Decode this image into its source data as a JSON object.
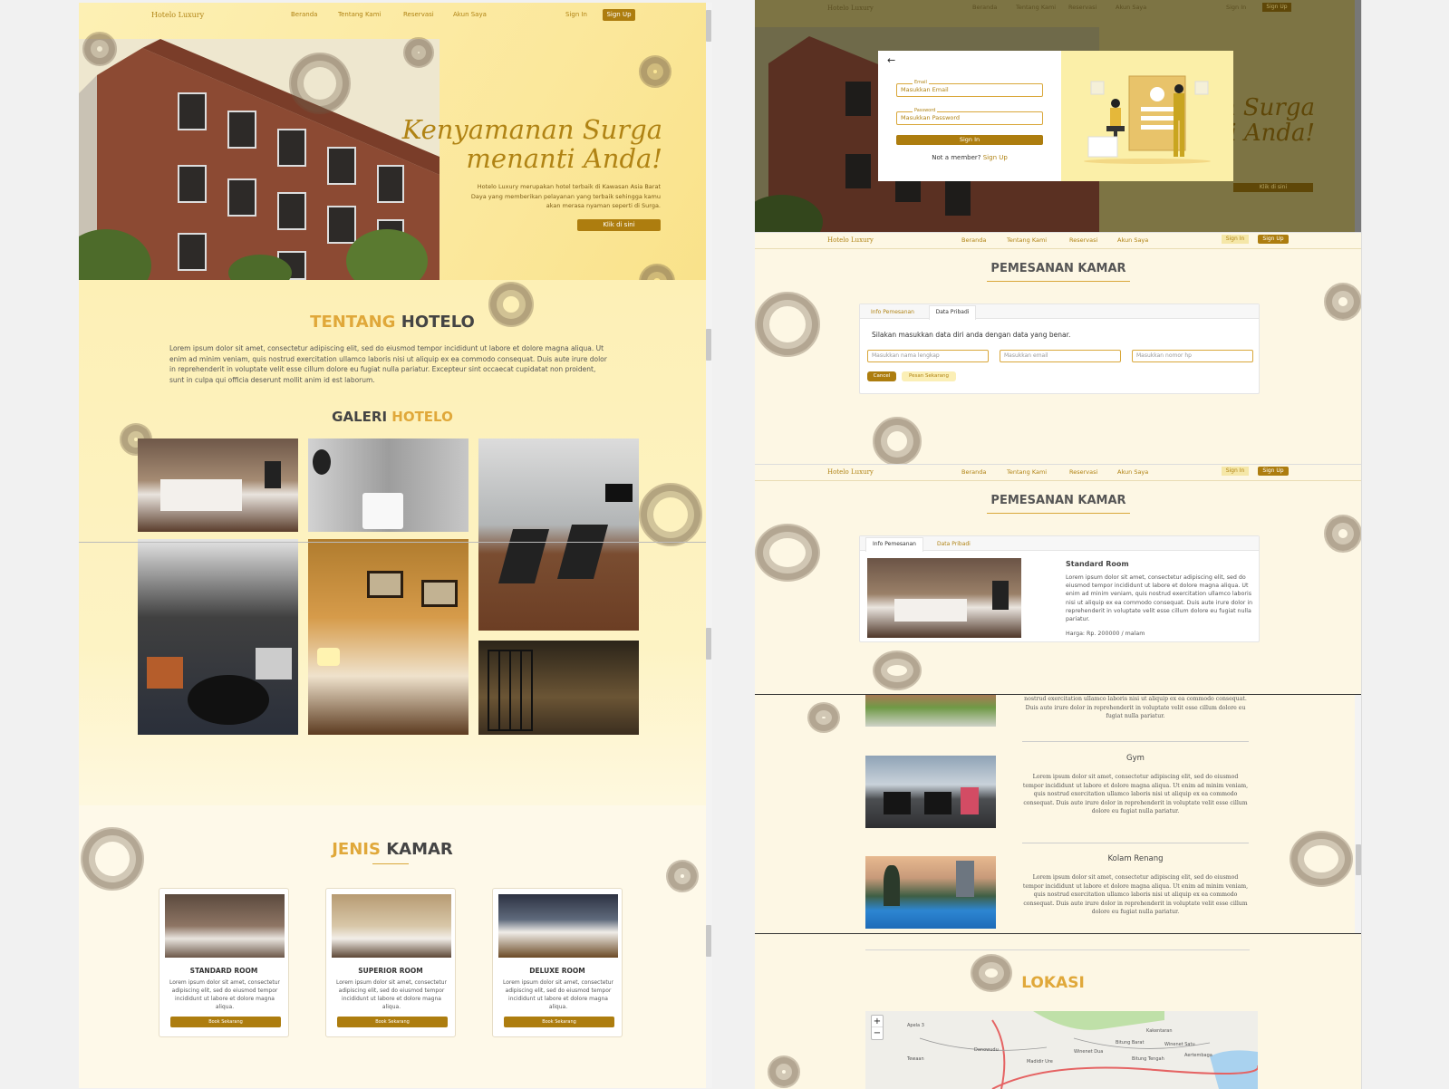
{
  "brand": "Hotelo Luxury",
  "nav": [
    "Beranda",
    "Tentang Kami",
    "Reservasi",
    "Akun Saya"
  ],
  "auth": {
    "signin": "Sign In",
    "signup": "Sign Up"
  },
  "hero": {
    "title_line1": "Kenyamanan Surga",
    "title_line2": "menanti Anda!",
    "text": "Hotelo Luxury merupakan hotel terbaik di Kawasan Asia Barat Daya yang memberikan pelayanan yang terbaik sehingga kamu akan merasa nyaman seperti di Surga.",
    "cta": "Klik di sini"
  },
  "about": {
    "title_a": "TENTANG",
    "title_b": "HOTELO",
    "text": "Lorem ipsum dolor sit amet, consectetur adipiscing elit, sed do eiusmod tempor incididunt ut labore et dolore magna aliqua. Ut enim ad minim veniam, quis nostrud exercitation ullamco laboris nisi ut aliquip ex ea commodo consequat. Duis aute irure dolor in reprehenderit in voluptate velit esse cillum dolore eu fugiat nulla pariatur. Excepteur sint occaecat cupidatat non proident, sunt in culpa qui officia deserunt mollit anim id est laborum."
  },
  "gallery": {
    "title_a": "GALERI",
    "title_b": "HOTELO"
  },
  "rooms": {
    "title_a": "JENIS",
    "title_b": "KAMAR",
    "items": [
      {
        "name": "STANDARD ROOM",
        "text": "Lorem ipsum dolor sit amet, consectetur adipiscing elit, sed do eiusmod tempor incididunt ut labore et dolore magna aliqua.",
        "cta": "Book Sekarang"
      },
      {
        "name": "SUPERIOR ROOM",
        "text": "Lorem ipsum dolor sit amet, consectetur adipiscing elit, sed do eiusmod tempor incididunt ut labore et dolore magna aliqua.",
        "cta": "Book Sekarang"
      },
      {
        "name": "DELUXE ROOM",
        "text": "Lorem ipsum dolor sit amet, consectetur adipiscing elit, sed do eiusmod tempor incididunt ut labore et dolore magna aliqua.",
        "cta": "Book Sekarang"
      }
    ]
  },
  "signin_modal": {
    "back": "←",
    "email_label": "Email",
    "email_placeholder": "Masukkan Email",
    "password_label": "Password",
    "password_placeholder": "Masukkan Password",
    "submit": "Sign In",
    "not_member": "Not a member?",
    "signup_link": "Sign Up"
  },
  "booking1": {
    "title": "PEMESANAN KAMAR",
    "tab_info": "Info Pemesanan",
    "tab_data": "Data Pribadi",
    "instruction": "Silakan masukkan data diri anda dengan data yang benar.",
    "name_placeholder": "Masukkan nama lengkap",
    "email_placeholder": "Masukkan email",
    "phone_placeholder": "Masukkan nomor hp",
    "cancel": "Cancel",
    "order": "Pesan Sekarang"
  },
  "booking2": {
    "title": "PEMESANAN KAMAR",
    "tab_info": "Info Pemesanan",
    "tab_data": "Data Pribadi",
    "room_name": "Standard Room",
    "room_text": "Lorem ipsum dolor sit amet, consectetur adipiscing elit, sed do eiusmod tempor incididunt ut labore et dolore magna aliqua. Ut enim ad minim veniam, quis nostrud exercitation ullamco laboris nisi ut aliquip ex ea commodo consequat. Duis aute irure dolor in reprehenderit in voluptate velit esse cillum dolore eu fugiat nulla pariatur.",
    "price": "Harga: Rp. 200000 / malam"
  },
  "facilities": {
    "top_text": "nostrud exercitation ullamco laboris nisi ut aliquip ex ea commodo consequat. Duis aute irure dolor in reprehenderit in voluptate velit esse cillum dolore eu fugiat nulla pariatur.",
    "items": [
      {
        "name": "Gym",
        "text": "Lorem ipsum dolor sit amet, consectetur adipiscing elit, sed do eiusmod tempor incididunt ut labore et dolore magna aliqua. Ut enim ad minim veniam, quis nostrud exercitation ullamco laboris nisi ut aliquip ex ea commodo consequat. Duis aute irure dolor in reprehenderit in voluptate velit esse cillum dolore eu fugiat nulla pariatur."
      },
      {
        "name": "Kolam Renang",
        "text": "Lorem ipsum dolor sit amet, consectetur adipiscing elit, sed do eiusmod tempor incididunt ut labore et dolore magna aliqua. Ut enim ad minim veniam, quis nostrud exercitation ullamco laboris nisi ut aliquip ex ea commodo consequat. Duis aute irure dolor in reprehenderit in voluptate velit esse cillum dolore eu fugiat nulla pariatur."
      }
    ]
  },
  "location": {
    "title": "LOKASI",
    "zoom_in": "+",
    "zoom_out": "−",
    "places": [
      "Apela 3",
      "Kakentaran",
      "Danowudu",
      "Bitung Barat",
      "Winenet Satu",
      "Winenet Dua",
      "Aertembaga",
      "Tewaan",
      "Madidir Ure",
      "Bitung Tengah"
    ]
  },
  "colors": {
    "gold": "#b08314",
    "cream": "#fdf7e4",
    "yellow": "#fdefae"
  }
}
